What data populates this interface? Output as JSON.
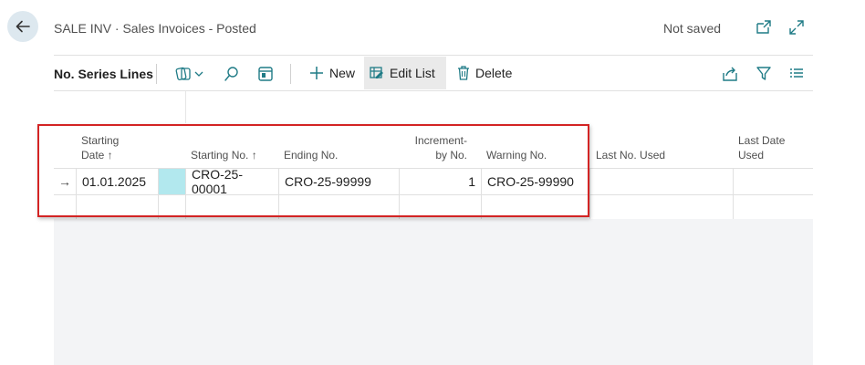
{
  "header": {
    "title": "SALE INV · Sales Invoices - Posted",
    "status": "Not saved"
  },
  "toolbar": {
    "part_title": "No. Series Lines",
    "new_label": "New",
    "edit_list_label": "Edit List",
    "delete_label": "Delete"
  },
  "columns": {
    "starting_date_1": "Starting",
    "starting_date_2": "Date ↑",
    "starting_no": "Starting No. ↑",
    "ending_no": "Ending No.",
    "increment_1": "Increment-",
    "increment_2": "by No.",
    "warning_no": "Warning No.",
    "last_no_used": "Last No. Used",
    "last_date_used_1": "Last Date",
    "last_date_used_2": "Used"
  },
  "rows": [
    {
      "selector": "→",
      "starting_date": "01.01.2025",
      "starting_no": "CRO-25-00001",
      "ending_no": "CRO-25-99999",
      "increment": "1",
      "warning_no": "CRO-25-99990",
      "last_no_used": "",
      "last_date_used": ""
    },
    {
      "selector": "",
      "starting_date": "",
      "starting_no": "",
      "ending_no": "",
      "increment": "",
      "warning_no": "",
      "last_no_used": "",
      "last_date_used": ""
    }
  ],
  "colors": {
    "accent": "#1f7b86",
    "highlight_cell": "#b2e8ee",
    "annotation": "#d32424"
  }
}
